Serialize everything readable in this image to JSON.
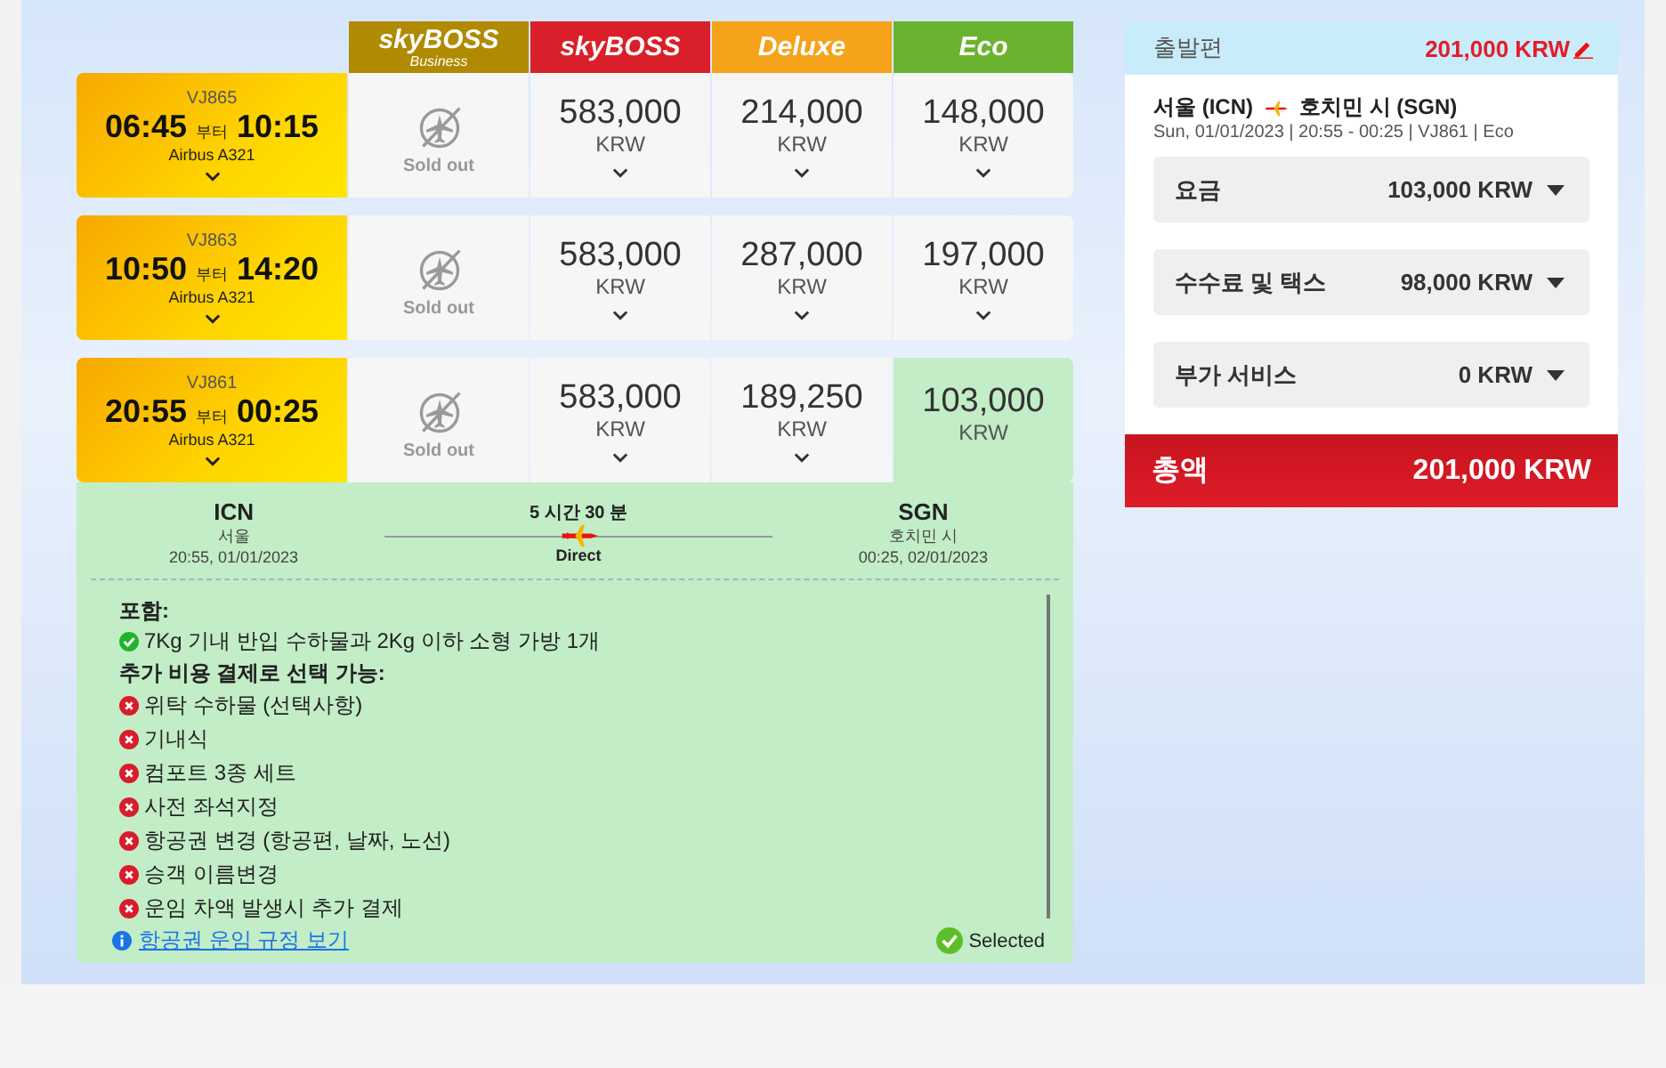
{
  "fare_classes": [
    {
      "logo": "skyBOSS",
      "sub": "Business",
      "color": "#b08a00"
    },
    {
      "logo": "skyBOSS",
      "color": "#d9202a"
    },
    {
      "logo": "Deluxe",
      "color": "#f5a31a"
    },
    {
      "logo": "Eco",
      "color": "#6ab32e"
    }
  ],
  "flights": [
    {
      "number": "VJ865",
      "depart": "06:45",
      "connector": "부터",
      "arrive": "10:15",
      "aircraft": "Airbus A321",
      "expanded": false,
      "fares": [
        {
          "kind": "sold_out",
          "label": "Sold out",
          "selected": false
        },
        {
          "kind": "price",
          "price": "583,000",
          "currency": "KRW",
          "selected": false
        },
        {
          "kind": "price",
          "price": "214,000",
          "currency": "KRW",
          "selected": false
        },
        {
          "kind": "price",
          "price": "148,000",
          "currency": "KRW",
          "selected": false
        }
      ]
    },
    {
      "number": "VJ863",
      "depart": "10:50",
      "connector": "부터",
      "arrive": "14:20",
      "aircraft": "Airbus A321",
      "expanded": false,
      "fares": [
        {
          "kind": "sold_out",
          "label": "Sold out",
          "selected": false
        },
        {
          "kind": "price",
          "price": "583,000",
          "currency": "KRW",
          "selected": false
        },
        {
          "kind": "price",
          "price": "287,000",
          "currency": "KRW",
          "selected": false
        },
        {
          "kind": "price",
          "price": "197,000",
          "currency": "KRW",
          "selected": false
        }
      ]
    },
    {
      "number": "VJ861",
      "depart": "20:55",
      "connector": "부터",
      "arrive": "00:25",
      "aircraft": "Airbus A321",
      "expanded": true,
      "fares": [
        {
          "kind": "sold_out",
          "label": "Sold out",
          "selected": false
        },
        {
          "kind": "price",
          "price": "583,000",
          "currency": "KRW",
          "selected": false
        },
        {
          "kind": "price",
          "price": "189,250",
          "currency": "KRW",
          "selected": false
        },
        {
          "kind": "price",
          "price": "103,000",
          "currency": "KRW",
          "selected": true
        }
      ]
    }
  ],
  "details": {
    "origin": {
      "code": "ICN",
      "city": "서울",
      "time": "20:55, 01/01/2023"
    },
    "duration": "5 시간 30 분",
    "stops": "Direct",
    "destination": {
      "code": "SGN",
      "city": "호치민 시",
      "time": "00:25, 02/01/2023"
    },
    "sections": [
      {
        "heading": "포함:",
        "items": [
          {
            "kind": "included",
            "text": "7Kg 기내 반입 수하물과 2Kg 이하 소형 가방 1개"
          }
        ]
      },
      {
        "heading": "추가 비용 결제로 선택 가능:",
        "items": [
          {
            "kind": "extra",
            "text": "위탁 수하물 (선택사항)"
          },
          {
            "kind": "extra",
            "text": "기내식"
          },
          {
            "kind": "extra",
            "text": "컴포트 3종 세트"
          },
          {
            "kind": "extra",
            "text": "사전 좌석지정"
          },
          {
            "kind": "extra",
            "text": "항공권 변경 (항공편, 날짜, 노선)"
          },
          {
            "kind": "extra",
            "text": "승객 이름변경"
          },
          {
            "kind": "extra",
            "text": "운임 차액 발생시 추가 결제"
          }
        ]
      }
    ],
    "rules_link": "항공권 운임 규정 보기",
    "selected_label": "Selected"
  },
  "summary": {
    "title": "출발편",
    "amount": "201,000 KRW",
    "from": "서울 (ICN)",
    "to": "호치민 시 (SGN)",
    "info": "Sun, 01/01/2023 | 20:55 - 00:25 | VJ861 | Eco",
    "lines": [
      {
        "label": "요금",
        "amount": "103,000 KRW",
        "expanded": false
      },
      {
        "label": "수수료 및 택스",
        "amount": "98,000 KRW",
        "expanded": false
      },
      {
        "label": "부가 서비스",
        "amount": "0 KRW",
        "expanded": false
      }
    ],
    "total_label": "총액",
    "total": "201,000 KRW"
  }
}
